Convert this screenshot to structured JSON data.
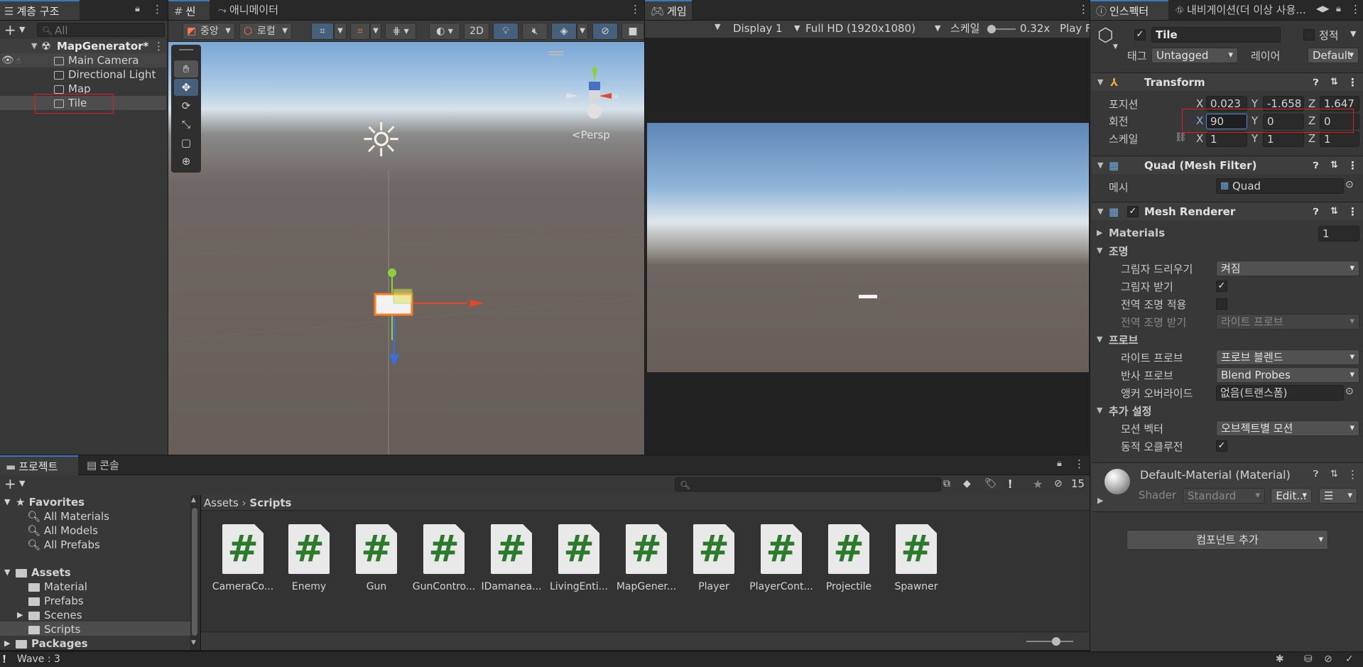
{
  "hierarchy": {
    "tab_label": "계층 구조",
    "search_placeholder": "All",
    "scene_name": "MapGenerator*",
    "items": [
      "Main Camera",
      "Directional Light",
      "Map",
      "Tile"
    ]
  },
  "scene": {
    "tab_label": "씬",
    "animator_tab_label": "애니메이터",
    "pivot_label": "중앙",
    "local_label": "로컬",
    "mode_2d_label": "2D",
    "persp_label": "Persp"
  },
  "game": {
    "tab_label": "게임",
    "display_value": "Display 1",
    "resolution_value": "Full HD (1920x1080)",
    "scale_label": "스케일",
    "scale_value": "0.32x",
    "play_label": "Play F"
  },
  "inspector": {
    "tab_label": "인스펙터",
    "nav_tab_label": "내비게이션(더 이상 사용...",
    "object_name": "Tile",
    "static_label": "정적",
    "tag_label": "태그",
    "tag_value": "Untagged",
    "layer_label": "레이어",
    "layer_value": "Default",
    "transform": {
      "title": "Transform",
      "position_label": "포지션",
      "rotation_label": "회전",
      "scale_label": "스케일",
      "axis_x": "X",
      "axis_y": "Y",
      "axis_z": "Z",
      "pos": [
        "0.023",
        "-1.658",
        "1.647"
      ],
      "rot": [
        "90",
        "0",
        "0"
      ],
      "scale": [
        "1",
        "1",
        "1"
      ]
    },
    "mesh_filter": {
      "title": "Quad (Mesh Filter)",
      "mesh_label": "메시",
      "mesh_value": "Quad"
    },
    "mesh_renderer": {
      "title": "Mesh Renderer",
      "materials_label": "Materials",
      "materials_count": "1",
      "lighting_label": "조명",
      "cast_shadows_label": "그림자 드리우기",
      "cast_shadows_value": "켜짐",
      "receive_shadows_label": "그림자 받기",
      "contribute_gi_label": "전역 조명 적용",
      "receive_gi_label": "전역 조명 받기",
      "receive_gi_value": "라이트 프로브",
      "probes_label": "프로브",
      "light_probes_label": "라이트 프로브",
      "light_probes_value": "프로브 블렌드",
      "reflection_probes_label": "반사 프로브",
      "reflection_probes_value": "Blend Probes",
      "anchor_override_label": "앵커 오버라이드",
      "anchor_override_value": "없음(트랜스폼)",
      "additional_label": "추가 설정",
      "motion_vectors_label": "모션 벡터",
      "motion_vectors_value": "오브젝트별 모션",
      "dynamic_occlusion_label": "동적 오클루전"
    },
    "material": {
      "title": "Default-Material (Material)",
      "shader_label": "Shader",
      "shader_value": "Standard",
      "edit_label": "Edit..."
    },
    "add_component_label": "컴포넌트 추가"
  },
  "project": {
    "tab_label": "프로젝트",
    "console_tab_label": "콘솔",
    "hidden_count": "15",
    "favorites_label": "Favorites",
    "favorites": [
      "All Materials",
      "All Models",
      "All Prefabs"
    ],
    "assets_label": "Assets",
    "asset_folders": [
      "Material",
      "Prefabs",
      "Scenes",
      "Scripts"
    ],
    "packages_label": "Packages",
    "breadcrumb_root": "Assets",
    "breadcrumb_current": "Scripts",
    "scripts": [
      "CameraCo...",
      "Enemy",
      "Gun",
      "GunContro...",
      "IDamanea...",
      "LivingEnti...",
      "MapGener...",
      "Player",
      "PlayerCont...",
      "Projectile",
      "Spawner"
    ]
  },
  "status_bar": {
    "message": "Wave : 3"
  }
}
